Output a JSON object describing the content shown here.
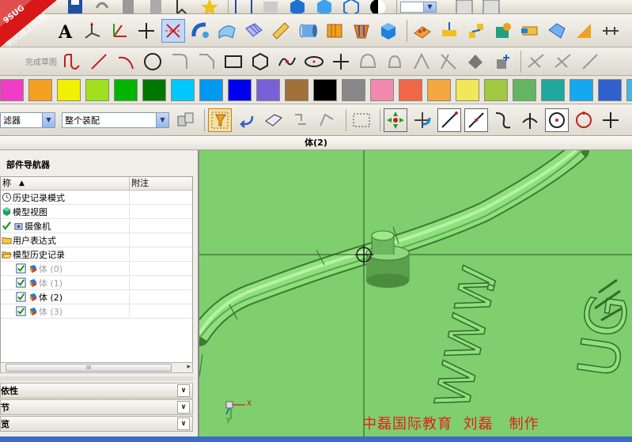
{
  "logo": {
    "line1": "9SUG",
    "line2": "学UG就上UG网"
  },
  "sketch_toolbar": {
    "label": "完成草图"
  },
  "colors": [
    "#f03cc8",
    "#f4a020",
    "#f0f000",
    "#a0e020",
    "#00b400",
    "#007800",
    "#00c8ff",
    "#0098f0",
    "#0000f0",
    "#7860d8",
    "#a07038",
    "#000000",
    "#888888",
    "#f088b0",
    "#f06848",
    "#f4a840",
    "#f0e858",
    "#a0c840",
    "#64b464",
    "#20a8a0",
    "#14a8f0",
    "#3060d0",
    "#40b8e8"
  ],
  "selection_bar": {
    "filter_value": "滤器",
    "assembly_value": "整个装配"
  },
  "window": {
    "title": "体(2)"
  },
  "navigator": {
    "title": "部件导航器",
    "col_name": "称",
    "col_note": "附注",
    "items": [
      {
        "label": "历史记录模式",
        "icon": "clock-icon",
        "gray": false,
        "check": false
      },
      {
        "label": "模型视图",
        "icon": "model-views-icon",
        "gray": false,
        "check": false
      },
      {
        "label": "摄像机",
        "icon": "camera-icon",
        "gray": false,
        "check": true
      },
      {
        "label": "用户表达式",
        "icon": "folder-icon",
        "gray": false,
        "check": false
      },
      {
        "label": "模型历史记录",
        "icon": "folder-open-icon",
        "gray": false,
        "check": false
      },
      {
        "label": "体 (0)",
        "icon": "body-icon",
        "gray": true,
        "check": true
      },
      {
        "label": "体 (1)",
        "icon": "body-icon",
        "gray": true,
        "check": true
      },
      {
        "label": "体 (2)",
        "icon": "body-icon",
        "gray": false,
        "check": true
      },
      {
        "label": "体 (3)",
        "icon": "body-icon",
        "gray": true,
        "check": true
      }
    ],
    "panels": [
      "依性",
      "节",
      "览"
    ]
  },
  "viewport": {
    "watermark": "中磊国际教育  刘磊   制作",
    "triad": {
      "x": "X",
      "y": "Y"
    }
  }
}
